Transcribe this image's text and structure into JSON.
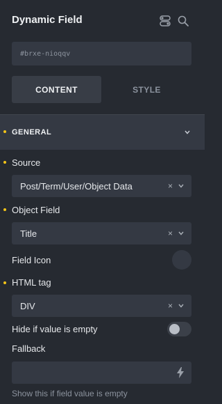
{
  "panel": {
    "title": "Dynamic Field",
    "element_id": "#brxe-nioqqv"
  },
  "icons": {
    "toggle_panel": "toggle-switch-icon",
    "search": "search-icon",
    "section_chevron": "chevron-down-icon",
    "dynamic_data": "lightning-bolt-icon"
  },
  "tabs": [
    {
      "label": "CONTENT",
      "active": true
    },
    {
      "label": "STYLE",
      "active": false
    }
  ],
  "section": {
    "title": "GENERAL",
    "expanded": true
  },
  "fields": {
    "source": {
      "label": "Source",
      "value": "Post/Term/User/Object Data",
      "clear": "×"
    },
    "object_field": {
      "label": "Object Field",
      "value": "Title",
      "clear": "×"
    },
    "field_icon": {
      "label": "Field Icon"
    },
    "html_tag": {
      "label": "HTML tag",
      "value": "DIV",
      "clear": "×"
    },
    "hide_if_empty": {
      "label": "Hide if value is empty",
      "enabled": false
    },
    "fallback": {
      "label": "Fallback",
      "value": "",
      "help": "Show this if field value is empty"
    }
  },
  "colors": {
    "background": "#262a31",
    "control": "#343943",
    "indicator_dot": "#f5c518",
    "muted_text": "#8c939e"
  }
}
